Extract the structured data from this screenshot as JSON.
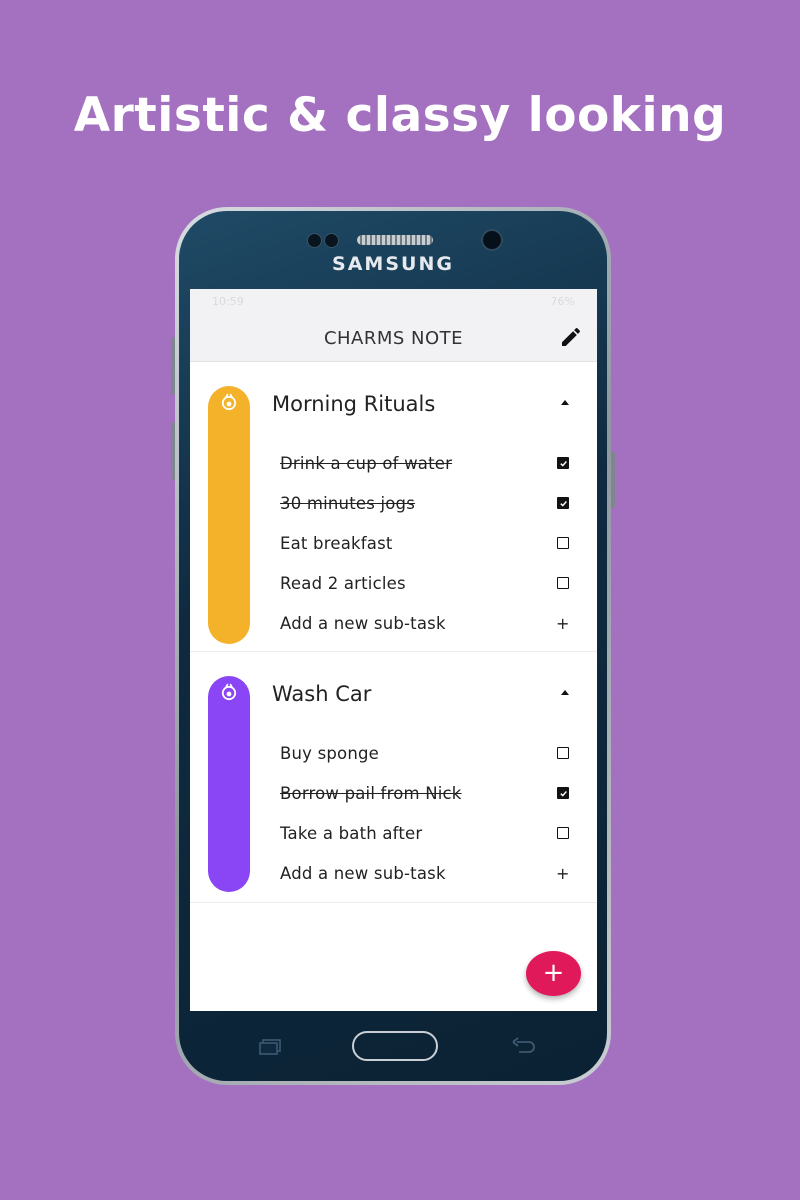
{
  "headline": "Artistic & classy looking",
  "device": {
    "brand": "SAMSUNG"
  },
  "statusbar": {
    "time": "10:59",
    "battery": "76%"
  },
  "app": {
    "title": "CHARMS NOTE"
  },
  "tasks": [
    {
      "title": "Morning Rituals",
      "color": "#f3b229",
      "subtasks": [
        {
          "label": "Drink a cup of water",
          "done": true
        },
        {
          "label": "30 minutes jogs",
          "done": true
        },
        {
          "label": "Eat breakfast",
          "done": false
        },
        {
          "label": "Read 2 articles",
          "done": false
        }
      ],
      "add_label": "Add a new sub-task"
    },
    {
      "title": "Wash Car",
      "color": "#8a46f4",
      "subtasks": [
        {
          "label": "Buy sponge",
          "done": false
        },
        {
          "label": "Borrow pail from Nick",
          "done": true
        },
        {
          "label": "Take a bath after",
          "done": false
        }
      ],
      "add_label": "Add a new sub-task"
    }
  ],
  "fab": {
    "icon": "plus-icon",
    "color": "#e0195a",
    "label": "+"
  }
}
